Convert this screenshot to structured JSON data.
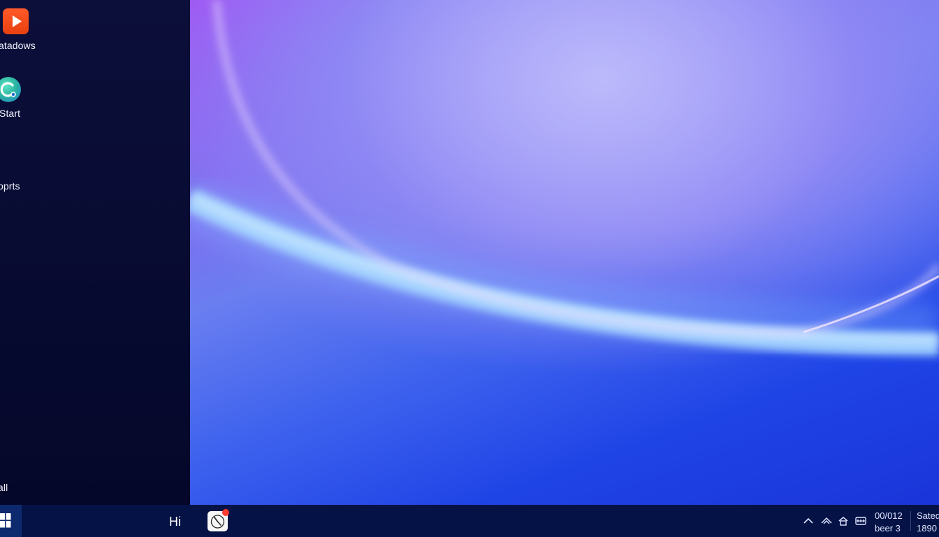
{
  "panel": {
    "items": [
      {
        "label": "atadows",
        "icon": "play-icon"
      },
      {
        "label": "Start",
        "icon": "app-logo-icon"
      },
      {
        "label": "oprts"
      },
      {
        "label": "all"
      }
    ]
  },
  "taskbar": {
    "start_icon": "windows-logo-icon",
    "label": "Hi",
    "app_icon": "clock-app-icon",
    "tray": {
      "icons": [
        "chevron-up-icon",
        "network-icon",
        "home-icon",
        "keyboard-icon"
      ],
      "line1a": "00/012",
      "line2a": "beer 3",
      "line1b": "Sated",
      "line2b": "1890"
    }
  },
  "colors": {
    "panel": "#070a30",
    "taskbar": "#041245",
    "accent_orange": "#ff5a2a",
    "accent_teal": "#2bb7a0",
    "badge_red": "#ff3b30"
  }
}
